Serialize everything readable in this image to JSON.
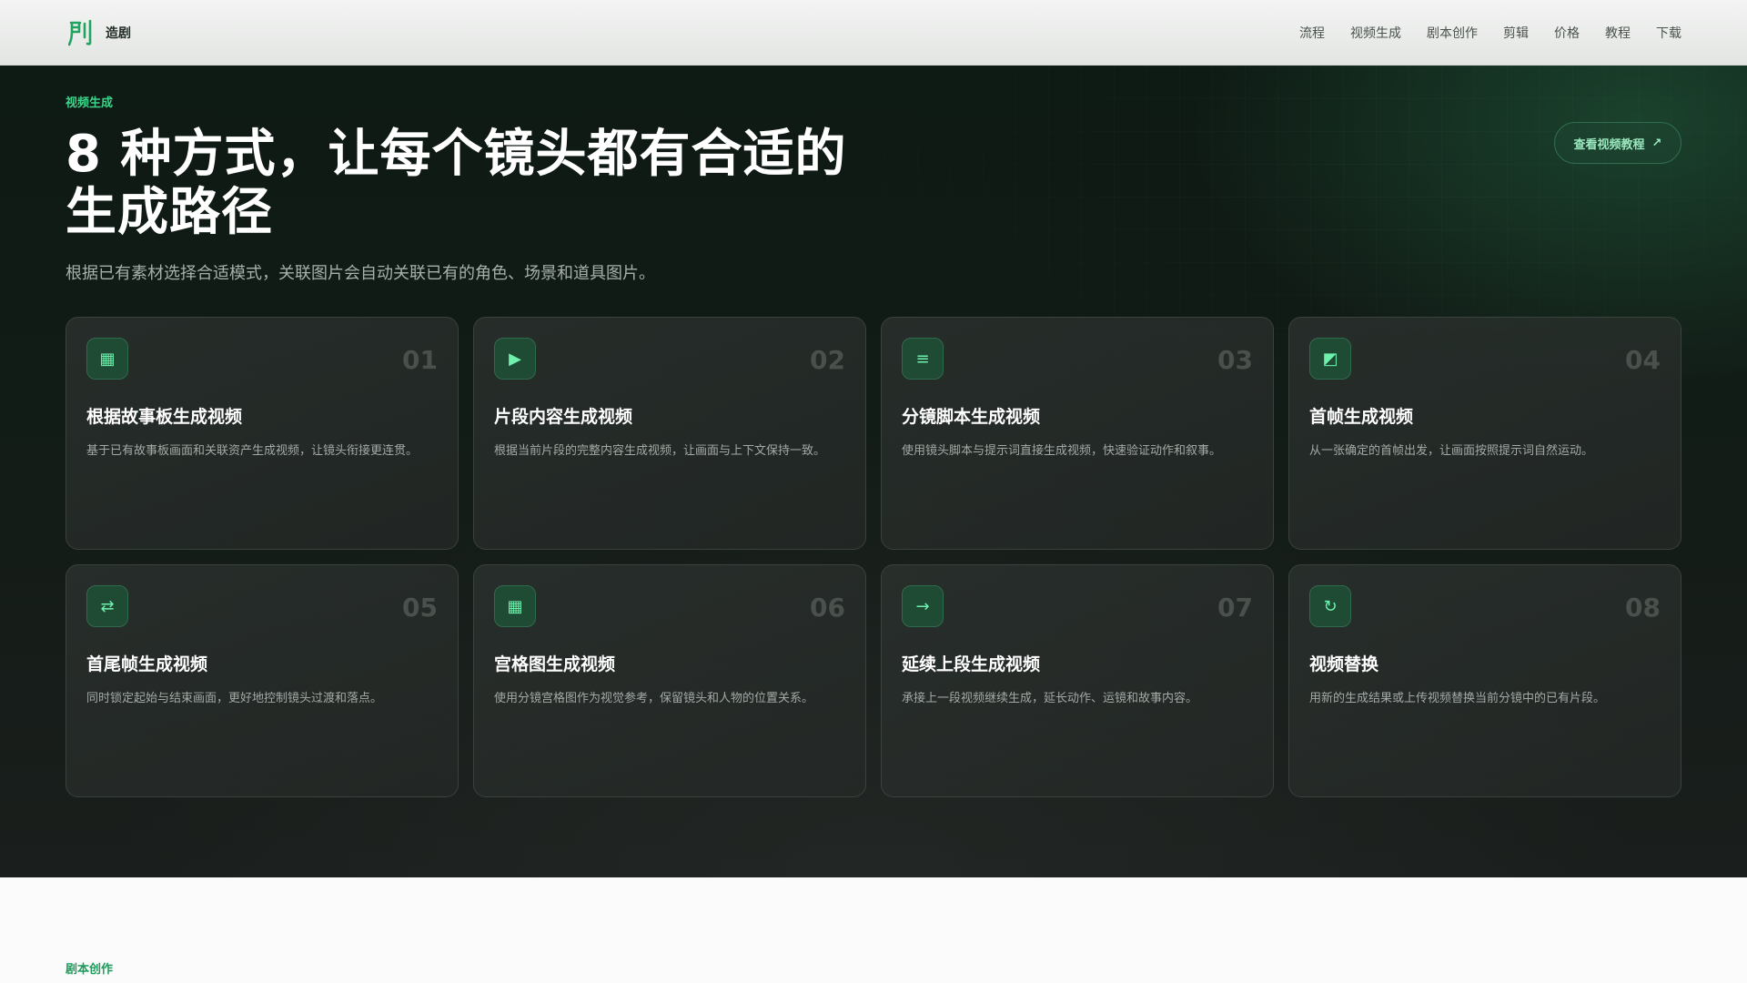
{
  "header": {
    "brand_name": "造剧",
    "nav": [
      "流程",
      "视频生成",
      "剧本创作",
      "剪辑",
      "价格",
      "教程",
      "下载"
    ]
  },
  "hero": {
    "eyebrow": "视频生成",
    "title_line1": "8 种方式，让每个镜头都有合适的",
    "title_line2": "生成路径",
    "subtitle": "根据已有素材选择合适模式，关联图片会自动关联已有的角色、场景和道具图片。",
    "tutorial_button": "查看视频教程",
    "tutorial_icon": "↗"
  },
  "cards": [
    {
      "num": "01",
      "icon": "▦",
      "icon_name": "grid-icon",
      "title": "根据故事板生成视频",
      "desc": "基于已有故事板画面和关联资产生成视频，让镜头衔接更连贯。"
    },
    {
      "num": "02",
      "icon": "▶",
      "icon_name": "play-icon",
      "title": "片段内容生成视频",
      "desc": "根据当前片段的完整内容生成视频，让画面与上下文保持一致。"
    },
    {
      "num": "03",
      "icon": "≡",
      "icon_name": "list-icon",
      "title": "分镜脚本生成视频",
      "desc": "使用镜头脚本与提示词直接生成视频，快速验证动作和叙事。"
    },
    {
      "num": "04",
      "icon": "◩",
      "icon_name": "frame-icon",
      "title": "首帧生成视频",
      "desc": "从一张确定的首帧出发，让画面按照提示词自然运动。"
    },
    {
      "num": "05",
      "icon": "⇄",
      "icon_name": "swap-arrows-icon",
      "title": "首尾帧生成视频",
      "desc": "同时锁定起始与结束画面，更好地控制镜头过渡和落点。"
    },
    {
      "num": "06",
      "icon": "▦",
      "icon_name": "grid-icon",
      "title": "宫格图生成视频",
      "desc": "使用分镜宫格图作为视觉参考，保留镜头和人物的位置关系。"
    },
    {
      "num": "07",
      "icon": "→",
      "icon_name": "arrow-right-icon",
      "title": "延续上段生成视频",
      "desc": "承接上一段视频继续生成，延长动作、运镜和故事内容。"
    },
    {
      "num": "08",
      "icon": "↻",
      "icon_name": "refresh-icon",
      "title": "视频替换",
      "desc": "用新的生成结果或上传视频替换当前分镜中的已有片段。"
    }
  ],
  "next_section": {
    "eyebrow": "剧本创作"
  },
  "colors": {
    "accent": "#3ed28a",
    "dark_bg": "#131c17",
    "card_bg": "#2c322f"
  }
}
